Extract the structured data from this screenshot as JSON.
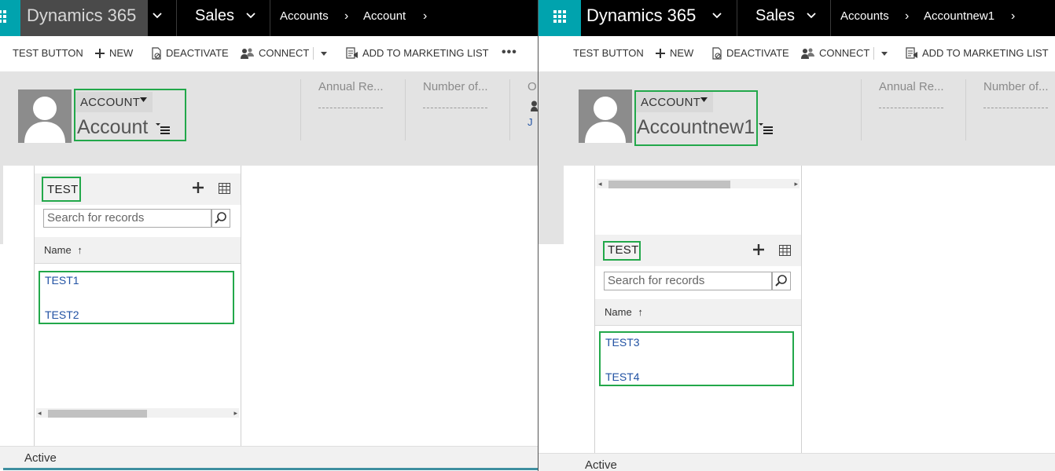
{
  "left": {
    "nav": {
      "app_name": "Dynamics 365",
      "area": "Sales",
      "breadcrumb": [
        "Accounts",
        "Account"
      ]
    },
    "commands": [
      "TEST BUTTON",
      "NEW",
      "DEACTIVATE",
      "CONNECT",
      "ADD TO MARKETING LIST"
    ],
    "header": {
      "entity_type": "ACCOUNT",
      "record_name": "Account",
      "fields": [
        "Annual Re...",
        "Number of...",
        "O"
      ],
      "owner_initial": "J"
    },
    "subgrid": {
      "title": "TEST",
      "search_placeholder": "Search for records",
      "column_header": "Name",
      "records": [
        "TEST1",
        "TEST2"
      ]
    },
    "status": "Active"
  },
  "right": {
    "nav": {
      "app_name": "Dynamics 365",
      "area": "Sales",
      "breadcrumb": [
        "Accounts",
        "Accountnew1"
      ]
    },
    "commands": [
      "TEST BUTTON",
      "NEW",
      "DEACTIVATE",
      "CONNECT",
      "ADD TO MARKETING LIST"
    ],
    "header": {
      "entity_type": "ACCOUNT",
      "record_name": "Accountnew1",
      "fields": [
        "Annual Re...",
        "Number of..."
      ]
    },
    "subgrid": {
      "title": "TEST",
      "search_placeholder": "Search for records",
      "column_header": "Name",
      "records": [
        "TEST3",
        "TEST4"
      ]
    },
    "status": "Active"
  },
  "colors": {
    "nav_bg": "#000000",
    "waffle_bg": "#00a3ae",
    "header_bg": "#e3e3e3",
    "highlight_border": "#22a84a",
    "link": "#2152a3"
  }
}
